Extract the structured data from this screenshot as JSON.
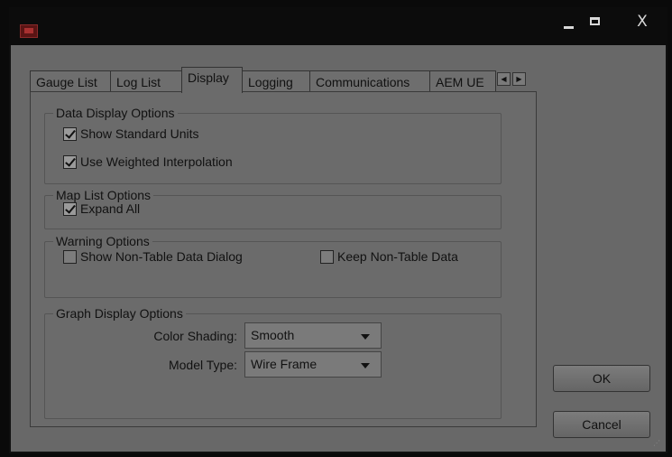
{
  "window": {
    "title": "",
    "buttons": {
      "close": "X"
    }
  },
  "tabs": [
    {
      "label": "Gauge List",
      "active": false
    },
    {
      "label": "Log List",
      "active": false
    },
    {
      "label": "Display",
      "active": true
    },
    {
      "label": "Logging",
      "active": false
    },
    {
      "label": "Communications",
      "active": false
    },
    {
      "label": "AEM UE",
      "active": false
    }
  ],
  "groups": {
    "data_display": {
      "legend": "Data Display Options",
      "options": [
        {
          "label": "Show Standard Units",
          "checked": true
        },
        {
          "label": "Use Weighted Interpolation",
          "checked": true
        }
      ]
    },
    "map_list": {
      "legend": "Map List Options",
      "options": [
        {
          "label": "Expand All",
          "checked": true
        }
      ]
    },
    "warning": {
      "legend": "Warning Options",
      "options": [
        {
          "label": "Show Non-Table Data Dialog",
          "checked": false
        },
        {
          "label": "Keep Non-Table Data",
          "checked": false
        }
      ]
    },
    "graph_display": {
      "legend": "Graph Display Options",
      "color_shading": {
        "label": "Color Shading:",
        "value": "Smooth"
      },
      "model_type": {
        "label": "Model Type:",
        "value": "Wire Frame"
      }
    }
  },
  "actions": {
    "ok": "OK",
    "cancel": "Cancel"
  },
  "colors": {
    "background": "#686868",
    "titlebar": "#0c0c0c",
    "icon": "#8a2a2a"
  }
}
